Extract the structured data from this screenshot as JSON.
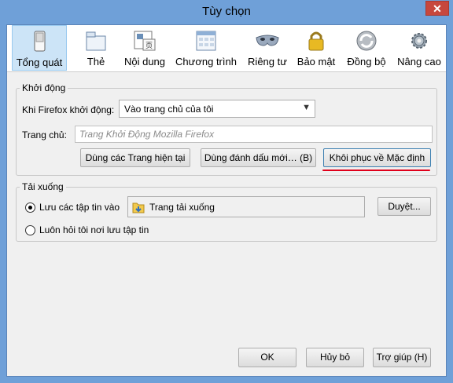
{
  "window": {
    "title": "Tùy chọn",
    "close_label": "✕"
  },
  "toolbar": {
    "tabs": [
      {
        "label": "Tổng quát",
        "icon": "switch-icon"
      },
      {
        "label": "Thẻ",
        "icon": "tabs-icon"
      },
      {
        "label": "Nội dung",
        "icon": "content-icon"
      },
      {
        "label": "Chương trình",
        "icon": "applications-icon"
      },
      {
        "label": "Riêng tư",
        "icon": "privacy-mask-icon"
      },
      {
        "label": "Bảo mật",
        "icon": "padlock-icon"
      },
      {
        "label": "Đồng bộ",
        "icon": "sync-icon"
      },
      {
        "label": "Nâng cao",
        "icon": "gear-icon"
      }
    ]
  },
  "startup": {
    "group_label": "Khởi động",
    "when_label": "Khi Firefox khởi động:",
    "when_value": "Vào trang chủ của tôi",
    "home_label": "Trang chủ:",
    "home_placeholder": "Trang Khởi Động Mozilla Firefox",
    "use_current_label": "Dùng các Trang hiện tại",
    "use_bookmark_label": "Dùng đánh dấu mới… (B)",
    "restore_default_label": "Khôi phục về Mặc định"
  },
  "downloads": {
    "group_label": "Tải xuống",
    "save_to_label": "Lưu các tập tin vào",
    "folder_value": "Trang tải xuống",
    "browse_label": "Duyệt...",
    "always_ask_label": "Luôn hỏi tôi nơi lưu tập tin"
  },
  "footer": {
    "ok_label": "OK",
    "cancel_label": "Hủy bỏ",
    "help_label": "Trợ giúp (H)"
  },
  "colors": {
    "accent_underline": "#e0001b",
    "titlebar": "#6fa0d8",
    "close": "#c7473d"
  }
}
